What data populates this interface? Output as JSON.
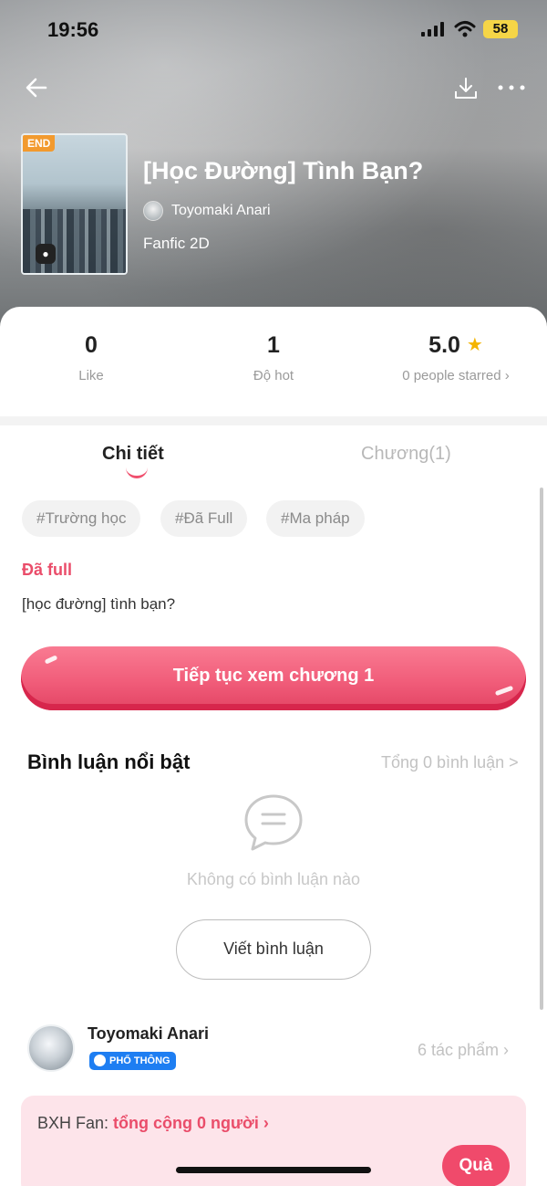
{
  "status_bar": {
    "time": "19:56",
    "battery": "58"
  },
  "story": {
    "end_badge": "END",
    "title": "[Học Đường] Tình Bạn?",
    "author": "Toyomaki Anari",
    "genre": "Fanfic 2D"
  },
  "stats": {
    "like_value": "0",
    "like_label": "Like",
    "hot_value": "1",
    "hot_label": "Độ hot",
    "rating_value": "5.0",
    "rating_label": "0 people starred ›"
  },
  "tabs": {
    "detail": "Chi tiết",
    "chapters": "Chương(1)"
  },
  "tags": [
    "#Trường học",
    "#Đã Full",
    "#Ma pháp"
  ],
  "status_text": "Đã full",
  "description": "[học đường] tình bạn?",
  "continue_button": "Tiếp tục xem chương 1",
  "comments": {
    "title": "Bình luận nổi bật",
    "total": "Tổng 0 bình luận >",
    "empty": "Không có bình luận nào",
    "write_button": "Viết bình luận"
  },
  "author_card": {
    "name": "Toyomaki Anari",
    "badge": "PHỔ THÔNG",
    "works": "6 tác phẩm ›"
  },
  "fan_ranking": {
    "label": "BXH Fan: ",
    "total": "tổng cộng 0 người ›",
    "gift_button": "Quà"
  },
  "colors": {
    "accent": "#f04a6b",
    "badge_blue": "#1e7ef2",
    "star": "#f4b400",
    "end_badge": "#f29a2e"
  }
}
